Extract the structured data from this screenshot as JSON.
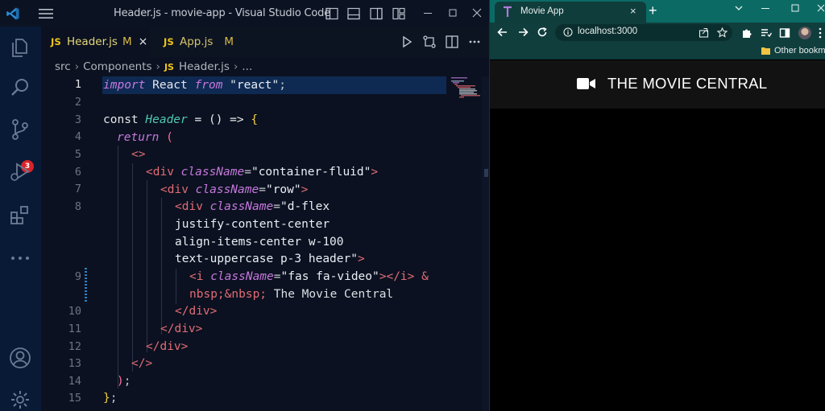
{
  "vscode": {
    "window_title": "Header.js - movie-app - Visual Studio Code",
    "source_control_badge": "3",
    "tabs": [
      {
        "lang": "JS",
        "name": "Header.js",
        "status": "M",
        "close": "×",
        "active": true
      },
      {
        "lang": "JS",
        "name": "App.js",
        "status": "M",
        "active": false
      }
    ],
    "breadcrumb": {
      "segments": [
        "src",
        "Components"
      ],
      "lang": "JS",
      "file": "Header.js",
      "more": "..."
    },
    "line_numbers": [
      "1",
      "2",
      "3",
      "4",
      "5",
      "6",
      "7",
      "8",
      "9",
      "10",
      "11",
      "12",
      "13",
      "14",
      "15"
    ],
    "code": {
      "l1_import": "import",
      "l1_react": " React ",
      "l1_from": "from",
      "l1_str": " \"react\"",
      "l1_semi": ";",
      "l3_const": "const",
      "l3_name": "Header",
      "l3_rest": " = () => ",
      "l3_brace": "{",
      "l4_return": "return",
      "l4_paren": "(",
      "l5_frag": "<>",
      "l6_open": "<div",
      "l6_attr": "className",
      "l6_val": "\"container-fluid\"",
      "l6_close": ">",
      "l7_open": "<div",
      "l7_attr": "className",
      "l7_val": "\"row\"",
      "l7_close": ">",
      "l8a_open": "<div",
      "l8a_attr": "className",
      "l8a_val": "\"d-flex",
      "l8b": "justify-content-center",
      "l8c": "align-items-center w-100",
      "l8d_val": "text-uppercase p-3 header\"",
      "l8d_close": ">",
      "l9a_open": "<i",
      "l9a_attr": "className",
      "l9a_val": "\"fas fa-video\"",
      "l9a_tags": "></i>",
      "l9a_amp": " &",
      "l9b_ent": "nbsp;&nbsp;",
      "l9b_text": " The Movie Central",
      "l10": "</div>",
      "l11": "</div>",
      "l12": "</div>",
      "l13": "</>",
      "l14_paren": ")",
      "l14_semi": ";",
      "l15_brace": "}",
      "l15_semi": ";"
    }
  },
  "browser": {
    "tab_title": "Movie App",
    "tab_close": "×",
    "new_tab": "+",
    "url": "localhost:3000",
    "bookmark": "Other bookmarks",
    "page_title": "THE MOVIE CENTRAL",
    "theme_color": "#0c6a65"
  }
}
